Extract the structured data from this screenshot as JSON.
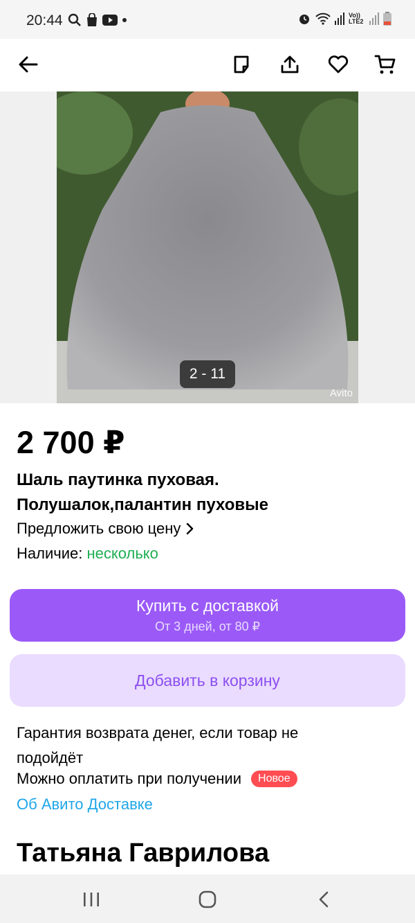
{
  "status_bar": {
    "time": "20:44",
    "left_icons": [
      "search-icon",
      "bag-icon",
      "youtube-icon",
      "dot-icon"
    ],
    "right_icons": [
      "alarm-icon",
      "wifi-icon",
      "signal-icon",
      "volte-icon",
      "signal-icon",
      "battery-icon"
    ],
    "volte_label": "Vo)) LTE2"
  },
  "toolbar": {
    "icons": [
      "back-arrow-icon",
      "note-icon",
      "share-icon",
      "heart-icon",
      "cart-icon"
    ]
  },
  "gallery": {
    "counter": "2 - 11",
    "watermark": "Avito"
  },
  "product": {
    "price": "2 700 ₽",
    "title": "Шаль паутинка пуховая. Полушалок,палантин пуховые",
    "offer_price": "Предложить свою цену",
    "availability_label": "Наличие:",
    "availability_value": "несколько"
  },
  "buttons": {
    "buy_label": "Купить с доставкой",
    "buy_sub": "От 3 дней, от 80 ₽",
    "cart_label": "Добавить в корзину"
  },
  "info": {
    "guarantee": "Гарантия возврата денег, если товар не подойдёт",
    "pay_on_receipt": "Можно оплатить при получении",
    "new_badge": "Новое",
    "avito_delivery_link": "Об Авито Доставке"
  },
  "seller": {
    "name": "Татьяна Гаврилова"
  },
  "colors": {
    "accent_purple": "#9b5af7",
    "light_purple": "#eadcff",
    "green": "#1fae52",
    "link_blue": "#1fa6e8",
    "badge_red": "#ff4d52"
  }
}
